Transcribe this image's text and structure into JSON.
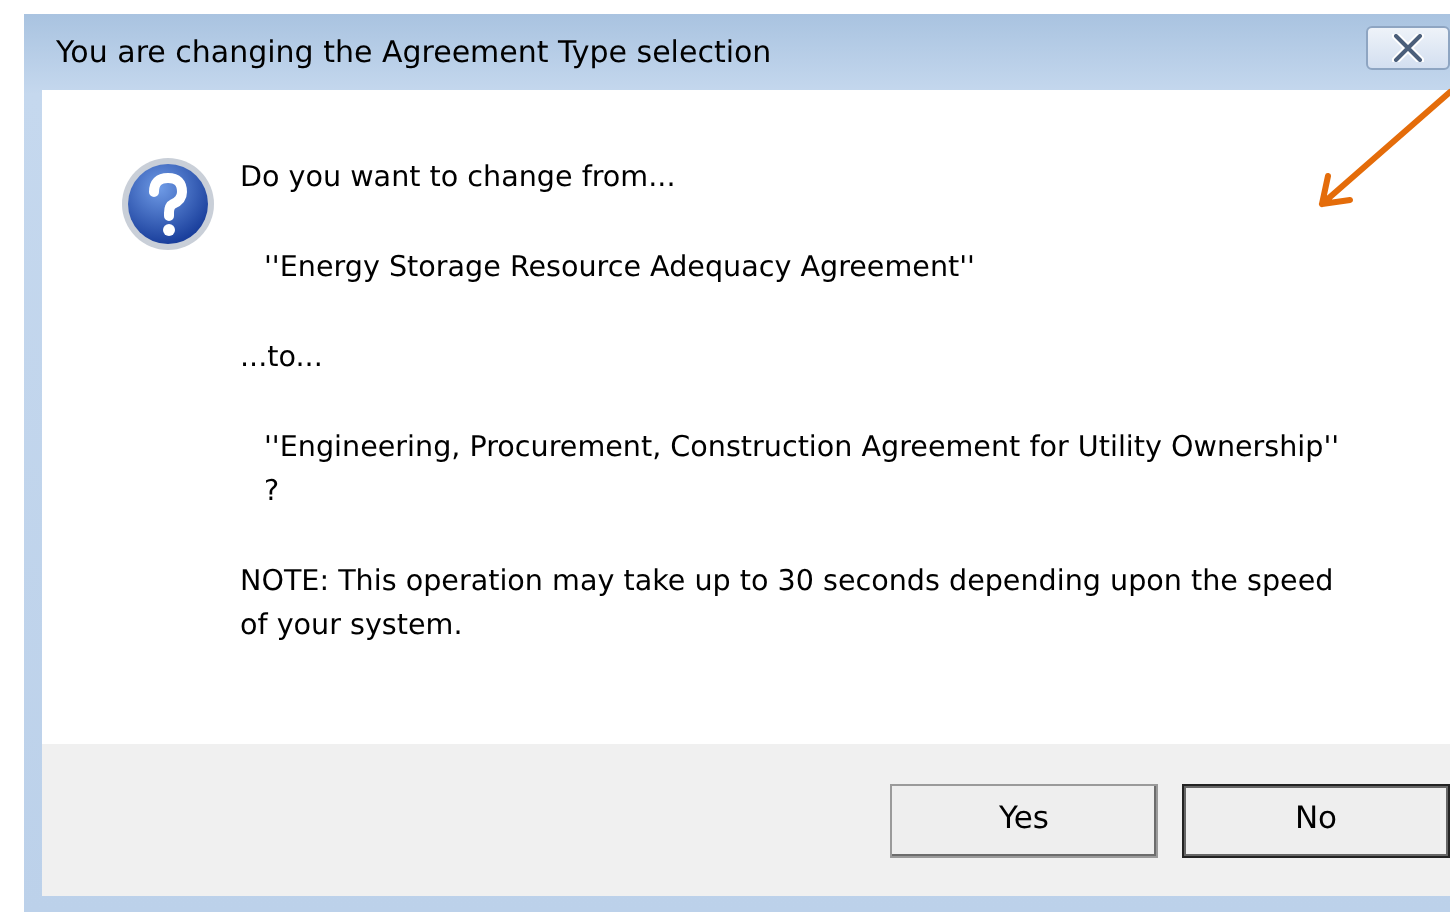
{
  "window": {
    "title": "You are changing the Agreement Type selection"
  },
  "message": {
    "paragraphs": [
      {
        "text": "Do you want to change from...",
        "indent": false
      },
      {
        "text": "''Energy Storage Resource Adequacy Agreement''",
        "indent": true
      },
      {
        "text": "...to...",
        "indent": false
      },
      {
        "text": "''Engineering, Procurement, Construction Agreement for Utility Ownership'' ?",
        "indent": true
      },
      {
        "text": "NOTE: This operation may take up to 30 seconds depending upon the speed of your system.",
        "indent": false
      }
    ]
  },
  "buttons": [
    {
      "label": "Yes",
      "default": false
    },
    {
      "label": "No",
      "default": true
    }
  ]
}
